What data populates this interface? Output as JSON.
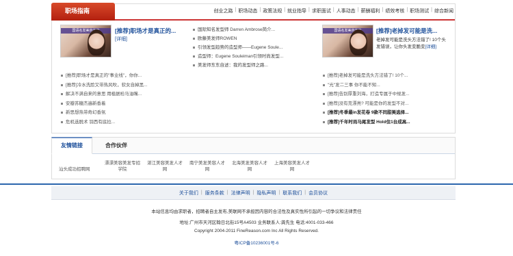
{
  "career": {
    "title": "职场指南",
    "nav": [
      "创业之路",
      "职场动态",
      "政策法规",
      "就业指导",
      "求职面试",
      "人事动态",
      "薪酬福利",
      "绩效考核",
      "职场测试",
      "综合新闻"
    ],
    "feature1": {
      "image_banner": "国语名发美容名店",
      "title": "[推荐]职场才是真正的...",
      "more": "[详细]"
    },
    "middle_list": [
      "国际知名发型师 Darren Ambrose简介...",
      "欧藤美发师ROWEN",
      "引领发型趋势的造型师——Eugene Soule...",
      "造型师：Eugene Souleiman引领时尚发型...",
      "美发师东东自述：我的发型师之路..."
    ],
    "feature2": {
      "image_banner": "国语名发美容名店",
      "title": "[推荐]老掉发可能是洗...",
      "desc": "老掉发可能是洗头方法错了! 10个头发错误，让你头发变脆变",
      "more": "[详细]"
    },
    "left_list": [
      "[推荐]职场才是真正的\"事业线\"，你你...",
      "[推荐]冷水洗脸又带热风吹，软女自掉黑...",
      "解决不满自来的意思 用植据检马油嘴...",
      "安瓣苏糖杰遍新香着",
      "新思想热带奇幻香氛",
      "危机选脱术 羽西有底拉..."
    ],
    "right_list": [
      {
        "text": "[推荐]老掉发可能是洗头方法错了! 10个...",
        "bold": false
      },
      {
        "text": "\"光\"发二三事 你不能不知...",
        "bold": false
      },
      {
        "text": "[推荐]告别厚重刘海，打造专属于中规发...",
        "bold": false
      },
      {
        "text": "[推荐]没有克漂亮? 可能是你的发型不对...",
        "bold": false
      },
      {
        "text": "[推荐]冬季最in发花卷 9款不同甜美选择...",
        "bold": true
      },
      {
        "text": "[推荐]千年时尚马尾发型 Hold住1台成高...",
        "bold": true
      }
    ]
  },
  "links": {
    "tab_friendly": "友情链接",
    "tab_partner": "合作伙伴",
    "cells": [
      {
        "line1": "",
        "line2": "汕头成功招聘网"
      },
      {
        "line1": "漂漂美容美发专招",
        "line2": "学院"
      },
      {
        "line1": "湛江美容美发人才",
        "line2": "网"
      },
      {
        "line1": "南宁美发美容人才",
        "line2": "网"
      },
      {
        "line1": "北海美发美容人才",
        "line2": "网"
      },
      {
        "line1": "上海美容美发人才",
        "line2": "网"
      }
    ]
  },
  "footer": {
    "nav": [
      "关于我们",
      "服务条款",
      "法律声明",
      "隐私声明",
      "联系我们",
      "会员协议"
    ],
    "disclaimer": "本站信息均由求职者，招聘者自主发布,美联网不承担因内容的合法性及真实性所引起的一切争议和法律责任",
    "address": "地址:广州市天河区翰日北街15号A4503 业务联系人:龚先生 电话:4001-033-466",
    "copyright": "Copyright 2004-2011 FineReason.com Inc All Rights Reserved.",
    "icp": "粤ICP备10236001号-6"
  },
  "colors": {
    "brand_red": "#c33",
    "link_blue": "#1d4f9a",
    "footer_line": "#2a65ad"
  }
}
